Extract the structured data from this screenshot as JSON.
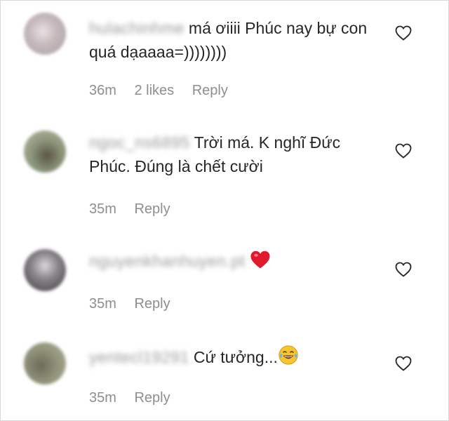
{
  "comments": [
    {
      "username": "hulachinhme",
      "text": "má ơiiii Phúc nay bự con quá dạaaaa=))))))))",
      "time": "36m",
      "likes": "2 likes",
      "reply": "Reply",
      "avatar_color": "#c9bfc2"
    },
    {
      "username": "ngoc_ns6895",
      "text": "Trời má. K nghĩ Đức Phúc. Đúng là chết cười",
      "time": "35m",
      "reply": "Reply",
      "avatar_color": "#8f9a7e"
    },
    {
      "username": "nguyenkhanhuyen.pt",
      "text": "",
      "emoji": "red-heart-emoji",
      "time": "35m",
      "reply": "Reply",
      "avatar_color": "#6d6a6f"
    },
    {
      "username": "yentecl19291",
      "text": "Cứ tưởng...",
      "emoji": "laughing-tears-emoji",
      "time": "35m",
      "reply": "Reply",
      "avatar_color": "#8c8f78"
    }
  ],
  "colors": {
    "text": "#262626",
    "meta": "#8e8e8e",
    "heart_red": "#ed4956"
  },
  "icons": {
    "like": "heart-outline-icon"
  }
}
